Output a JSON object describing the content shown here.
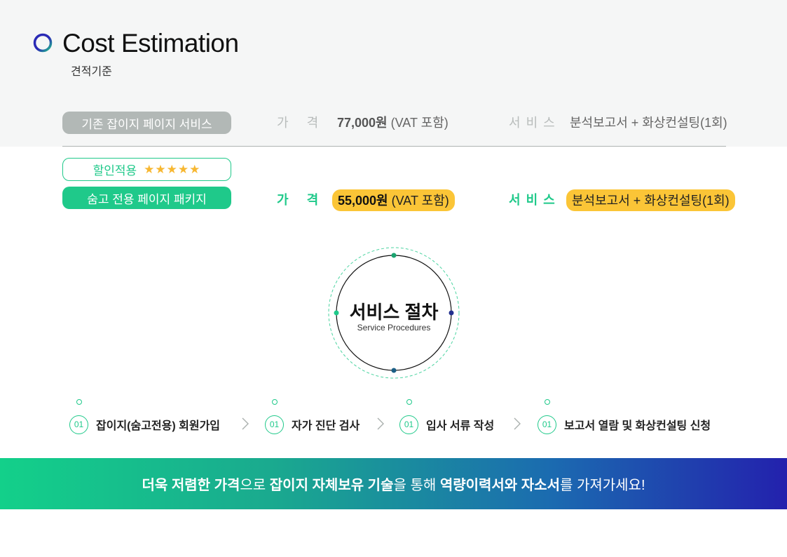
{
  "header": {
    "title": "Cost Estimation",
    "subtitle": "견적기준"
  },
  "existing": {
    "badge": "기존 잡이지 페이지 서비스",
    "price_label": [
      "가",
      "격"
    ],
    "price_value": "77,000원",
    "price_note": " (VAT 포함)",
    "service_label": [
      "서",
      "비",
      "스"
    ],
    "service_value": "분석보고서 + 화상컨설팅(1회)"
  },
  "discount": {
    "badge": "할인적용",
    "stars": "★★★★★",
    "package": "숨고 전용 페이지 패키지",
    "price_label": [
      "가",
      "격"
    ],
    "price_value": "55,000원",
    "price_note": " (VAT 포함)",
    "service_label": [
      "서",
      "비",
      "스"
    ],
    "service_value": "분석보고서 + 화상컨설팅(1회)"
  },
  "procedure": {
    "title": "서비스 절차",
    "subtitle": "Service Procedures",
    "steps": [
      {
        "num": "01",
        "text": "잡이지(숨고전용) 회원가입"
      },
      {
        "num": "01",
        "text": "자가 진단 검사"
      },
      {
        "num": "01",
        "text": "입사 서류 작성"
      },
      {
        "num": "01",
        "text": "보고서 열람 및 화상컨설팅 신청"
      }
    ]
  },
  "banner": {
    "parts": [
      {
        "text": "더욱 저렴한 가격",
        "bold": true
      },
      {
        "text": "으로 ",
        "bold": false
      },
      {
        "text": "잡이지 자체보유 기술",
        "bold": true
      },
      {
        "text": "을 통해 ",
        "bold": false
      },
      {
        "text": "역량이력서와 자소서",
        "bold": true
      },
      {
        "text": "를 가져가세요!",
        "bold": false
      }
    ]
  },
  "colors": {
    "accent_green": "#1fc98a",
    "highlight_yellow": "#fbc537",
    "gray_badge": "#b2b8b6",
    "navy": "#2321ad"
  }
}
